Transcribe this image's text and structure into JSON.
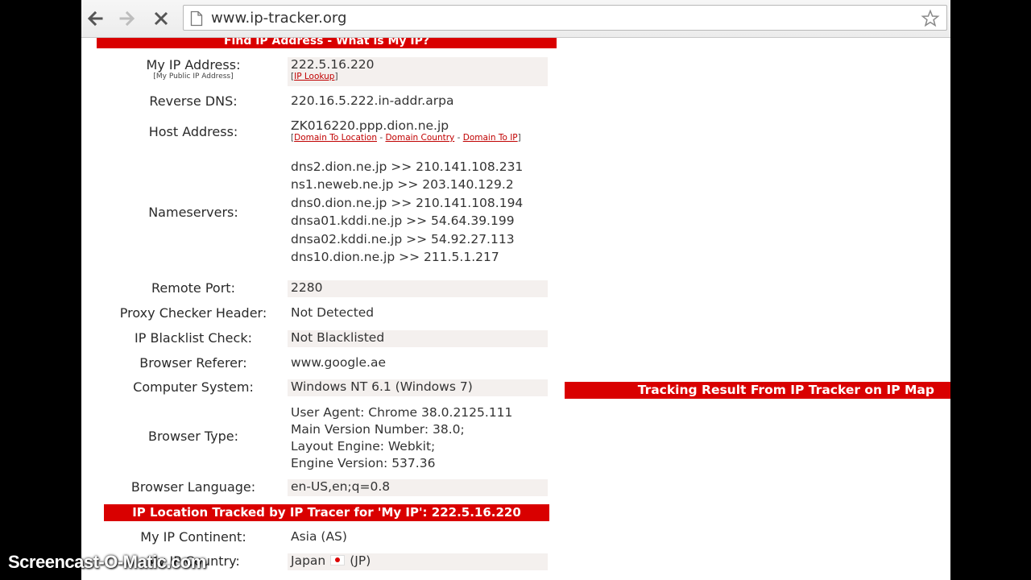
{
  "browser": {
    "url": "www.ip-tracker.org"
  },
  "page": {
    "top_banner": "Find IP Address - What is My IP?",
    "my_ip": {
      "label": "My IP Address:",
      "sublabel": "[My Public IP Address]",
      "value": "222.5.16.220",
      "link": "IP Lookup"
    },
    "reverse_dns": {
      "label": "Reverse DNS:",
      "value": "220.16.5.222.in-addr.arpa"
    },
    "host": {
      "label": "Host Address:",
      "value": "ZK016220.ppp.dion.ne.jp",
      "links": [
        "Domain To Location",
        "Domain Country",
        "Domain To IP"
      ]
    },
    "nameservers": {
      "label": "Nameservers:",
      "values": [
        "dns2.dion.ne.jp >> 210.141.108.231",
        "ns1.neweb.ne.jp >> 203.140.129.2",
        "dns0.dion.ne.jp >> 210.141.108.194",
        "dnsa01.kddi.ne.jp >> 54.64.39.199",
        "dnsa02.kddi.ne.jp >> 54.92.27.113",
        "dns10.dion.ne.jp >> 211.5.1.217"
      ]
    },
    "remote_port": {
      "label": "Remote Port:",
      "value": "2280"
    },
    "proxy": {
      "label": "Proxy Checker Header:",
      "value": "Not Detected"
    },
    "blacklist": {
      "label": "IP Blacklist Check:",
      "value": "Not Blacklisted"
    },
    "referer": {
      "label": "Browser Referer:",
      "value": "www.google.ae"
    },
    "system": {
      "label": "Computer System:",
      "value": "Windows NT 6.1 (Windows 7)"
    },
    "browser_type": {
      "label": "Browser Type:",
      "values": [
        "User Agent: Chrome 38.0.2125.111",
        "Main Version Number: 38.0;",
        "Layout Engine: Webkit;",
        "Engine Version: 537.36"
      ]
    },
    "language": {
      "label": "Browser Language:",
      "value": "en-US,en;q=0.8"
    },
    "location_banner": "IP Location Tracked by IP Tracer for 'My IP': 222.5.16.220",
    "continent": {
      "label": "My IP Continent:",
      "value": "Asia (AS)"
    },
    "country": {
      "label": "My IP Country:",
      "value": "Japan",
      "code": "(JP)"
    },
    "map_banner": "Tracking Result From IP Tracker on IP Map"
  },
  "watermark": "Screencast-O-Matic.com"
}
